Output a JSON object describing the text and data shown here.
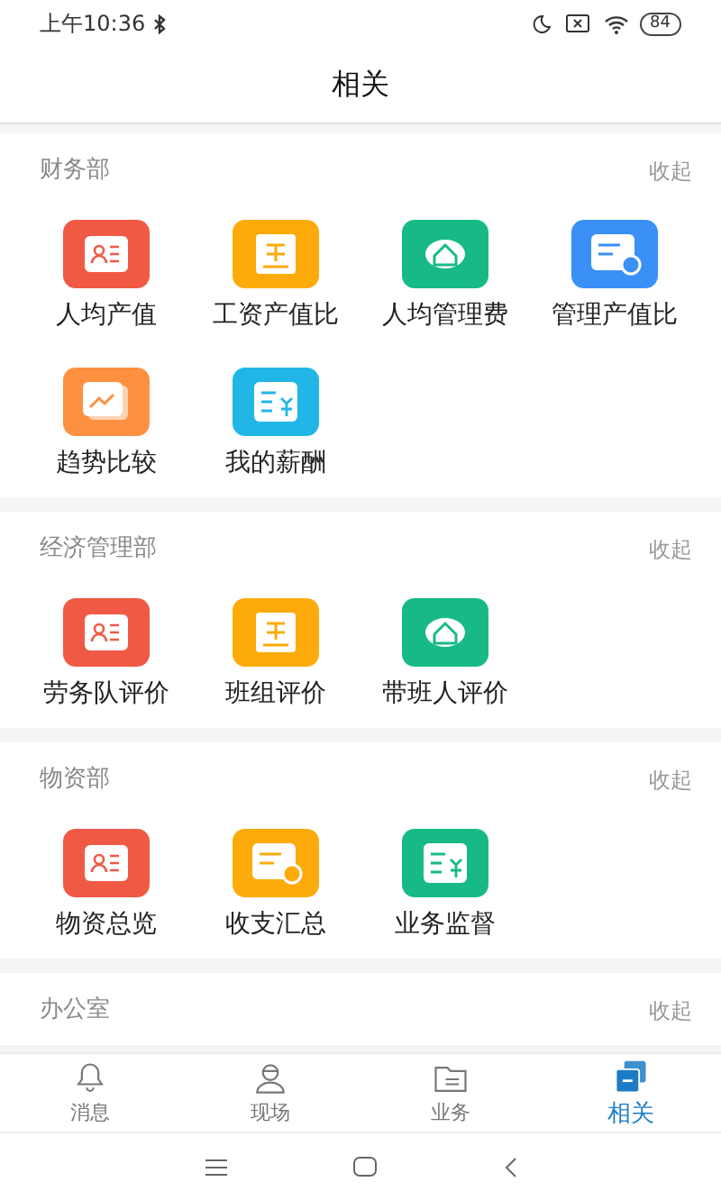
{
  "status_bar": {
    "time": "上午10:36",
    "battery": "84"
  },
  "header": {
    "title": "相关"
  },
  "sections": [
    {
      "title": "财务部",
      "action": "收起",
      "tiles": [
        {
          "label": "人均产值",
          "color": "#f05a45"
        },
        {
          "label": "工资产值比",
          "color": "#fcab0a"
        },
        {
          "label": "人均管理费",
          "color": "#17ba86"
        },
        {
          "label": "管理产值比",
          "color": "#3a90f6"
        },
        {
          "label": "趋势比较",
          "color": "#fd9140"
        },
        {
          "label": "我的薪酬",
          "color": "#22b6e6"
        }
      ]
    },
    {
      "title": "经济管理部",
      "action": "收起",
      "tiles": [
        {
          "label": "劳务队评价",
          "color": "#f05a45"
        },
        {
          "label": "班组评价",
          "color": "#fcab0a"
        },
        {
          "label": "带班人评价",
          "color": "#17ba86"
        }
      ]
    },
    {
      "title": "物资部",
      "action": "收起",
      "tiles": [
        {
          "label": "物资总览",
          "color": "#f05a45"
        },
        {
          "label": "收支汇总",
          "color": "#fcab0a"
        },
        {
          "label": "业务监督",
          "color": "#17ba86"
        }
      ]
    },
    {
      "title": "办公室",
      "action": "收起"
    }
  ],
  "tabs": [
    {
      "label": "消息",
      "kind": "bell",
      "selected": false
    },
    {
      "label": "现场",
      "kind": "worker",
      "selected": false
    },
    {
      "label": "业务",
      "kind": "folder",
      "selected": false
    },
    {
      "label": "相关",
      "kind": "stack",
      "selected": true
    }
  ]
}
